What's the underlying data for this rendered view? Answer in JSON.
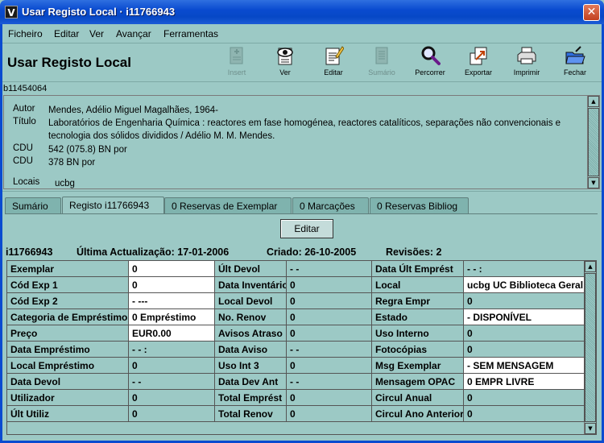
{
  "window": {
    "title": "Usar Registo Local · i11766943",
    "app_icon": "V",
    "close_glyph": "✕"
  },
  "menu": [
    "Ficheiro",
    "Editar",
    "Ver",
    "Avançar",
    "Ferramentas"
  ],
  "header": {
    "title": "Usar Registo Local"
  },
  "toolbar": [
    {
      "label": "Insert",
      "icon": "insert-icon",
      "enabled": false
    },
    {
      "label": "Ver",
      "icon": "view-eye-icon",
      "enabled": true
    },
    {
      "label": "Editar",
      "icon": "edit-pencil-icon",
      "enabled": true
    },
    {
      "label": "Sumário",
      "icon": "summary-icon",
      "enabled": false
    },
    {
      "label": "Percorrer",
      "icon": "magnifier-icon",
      "enabled": true
    },
    {
      "label": "Exportar",
      "icon": "export-icon",
      "enabled": true
    },
    {
      "label": "Imprimir",
      "icon": "printer-icon",
      "enabled": true
    },
    {
      "label": "Fechar",
      "icon": "folder-close-icon",
      "enabled": true
    }
  ],
  "bib_record": {
    "id": "b11454064",
    "fields": [
      {
        "label": "Autor",
        "value": "Mendes, Adélio Miguel Magalhães, 1964-"
      },
      {
        "label": "Título",
        "value": "Laboratórios de Engenharia Química : reactores em fase homogénea, reactores catalíticos, separações não convencionais e tecnologia dos sólidos divididos / Adélio M. M. Mendes."
      },
      {
        "label": "CDU",
        "value": "542 (075.8) BN por"
      },
      {
        "label": "CDU",
        "value": "378 BN por"
      },
      {
        "label": "Locais",
        "value": "ucbg"
      }
    ]
  },
  "tabs": [
    "Sumário",
    "Registo i11766943",
    "0 Reservas de Exemplar",
    "0 Marcações",
    "0 Reservas Bibliog"
  ],
  "active_tab": 1,
  "edit_button": "Editar",
  "summary": {
    "record": "i11766943",
    "last_update": "Última Actualização: 17-01-2006",
    "created": "Criado: 26-10-2005",
    "revisions": "Revisões: 2"
  },
  "grid": [
    [
      {
        "l": "Exemplar",
        "v": "0",
        "w": true
      },
      {
        "l": "Últ Devol",
        "v": "- -",
        "w": false
      },
      {
        "l": "Data Últ Emprést",
        "v": "- -        :",
        "w": false
      }
    ],
    [
      {
        "l": "Cód Exp 1",
        "v": "0",
        "w": true
      },
      {
        "l": "Data Inventário",
        "v": "0",
        "w": false
      },
      {
        "l": "Local",
        "v": "ucbg    UC Biblioteca Geral",
        "w": true
      }
    ],
    [
      {
        "l": "Cód Exp 2",
        "v": "-    ---",
        "w": true
      },
      {
        "l": "Local Devol",
        "v": "0",
        "w": false
      },
      {
        "l": "Regra Empr",
        "v": "0",
        "w": false
      }
    ],
    [
      {
        "l": "Categoria de Empréstimo",
        "v": "0    Empréstimo",
        "w": true
      },
      {
        "l": "No. Renov",
        "v": "0",
        "w": false
      },
      {
        "l": "Estado",
        "v": "-    DISPONÍVEL",
        "w": true
      }
    ],
    [
      {
        "l": "Preço",
        "v": "EUR0.00",
        "w": true
      },
      {
        "l": "Avisos Atraso",
        "v": "0",
        "w": false
      },
      {
        "l": "Uso Interno",
        "v": "0",
        "w": false
      }
    ],
    [
      {
        "l": "Data Empréstimo",
        "v": "- -        :",
        "w": false
      },
      {
        "l": "Data Aviso",
        "v": "- -",
        "w": false
      },
      {
        "l": "Fotocópias",
        "v": "0",
        "w": false
      }
    ],
    [
      {
        "l": "Local Empréstimo",
        "v": "0",
        "w": false
      },
      {
        "l": "Uso Int 3",
        "v": "0",
        "w": false
      },
      {
        "l": "Msg Exemplar",
        "v": "-    SEM MENSAGEM",
        "w": true
      }
    ],
    [
      {
        "l": "Data Devol",
        "v": "- -",
        "w": false
      },
      {
        "l": "Data Dev Ant",
        "v": "- -",
        "w": false
      },
      {
        "l": "Mensagem OPAC",
        "v": "0    EMPR LIVRE",
        "w": true
      }
    ],
    [
      {
        "l": "Utilizador",
        "v": "0",
        "w": false
      },
      {
        "l": "Total Emprést",
        "v": "0",
        "w": false
      },
      {
        "l": "Circul Anual",
        "v": "0",
        "w": false
      }
    ],
    [
      {
        "l": "Últ Utiliz",
        "v": "0",
        "w": false
      },
      {
        "l": "Total Renov",
        "v": "0",
        "w": false
      },
      {
        "l": "Circul Ano Anterior",
        "v": "0",
        "w": false
      }
    ]
  ]
}
